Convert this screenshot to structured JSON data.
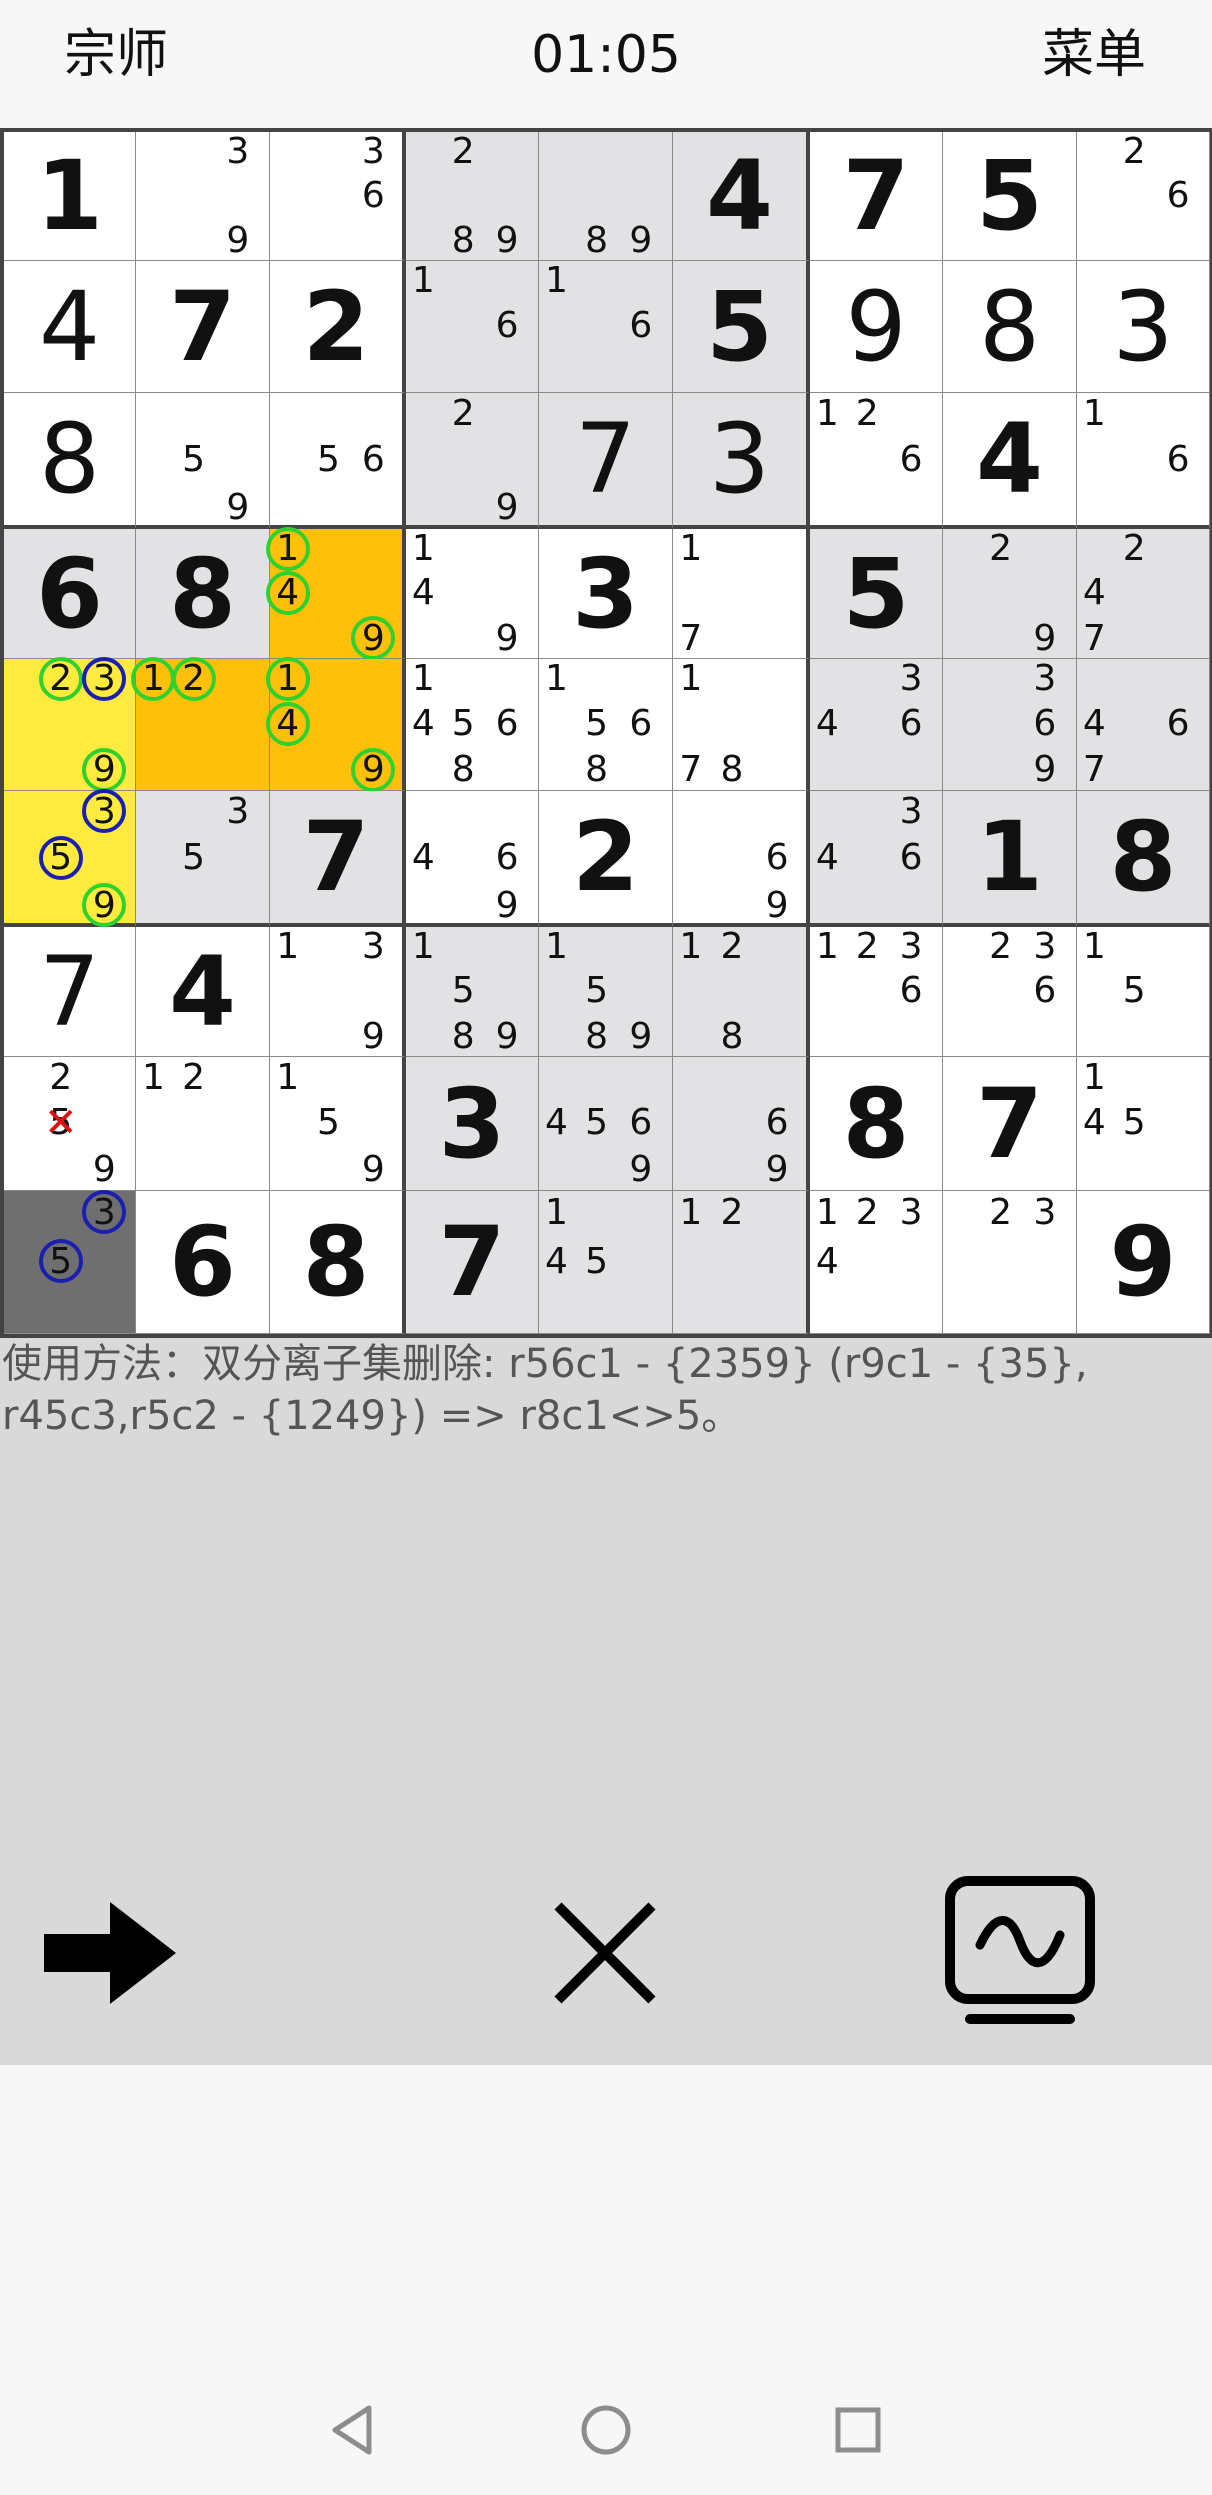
{
  "header": {
    "level": "宗师",
    "timer": "01:05",
    "menu": "菜单"
  },
  "grid": [
    [
      {
        "v": "1",
        "bg": "white"
      },
      {
        "c": [
          "3",
          "9"
        ],
        "bg": "white"
      },
      {
        "c": [
          "3",
          "6"
        ],
        "bg": "white"
      },
      {
        "c": [
          "2",
          "8",
          "9"
        ],
        "bg": "gray"
      },
      {
        "c": [
          "8",
          "9"
        ],
        "bg": "gray"
      },
      {
        "v": "4",
        "bg": "gray"
      },
      {
        "v": "7",
        "bg": "white"
      },
      {
        "v": "5",
        "bg": "white"
      },
      {
        "c": [
          "2",
          "6"
        ],
        "bg": "white"
      }
    ],
    [
      {
        "v": "4",
        "u": true,
        "bg": "white"
      },
      {
        "v": "7",
        "bg": "white"
      },
      {
        "v": "2",
        "bg": "white"
      },
      {
        "c": [
          "1",
          "6"
        ],
        "bg": "gray"
      },
      {
        "c": [
          "1",
          "6"
        ],
        "bg": "gray"
      },
      {
        "v": "5",
        "bg": "gray"
      },
      {
        "v": "9",
        "u": true,
        "bg": "white"
      },
      {
        "v": "8",
        "u": true,
        "bg": "white"
      },
      {
        "v": "3",
        "u": true,
        "bg": "white"
      }
    ],
    [
      {
        "v": "8",
        "u": true,
        "bg": "white"
      },
      {
        "c": [
          "5",
          "9"
        ],
        "bg": "white"
      },
      {
        "c": [
          "5",
          "6"
        ],
        "bg": "white"
      },
      {
        "c": [
          "2",
          "9"
        ],
        "bg": "gray"
      },
      {
        "v": "7",
        "u": true,
        "bg": "gray"
      },
      {
        "v": "3",
        "u": true,
        "bg": "gray"
      },
      {
        "c": [
          "1",
          "2",
          "6"
        ],
        "bg": "white"
      },
      {
        "v": "4",
        "bg": "white"
      },
      {
        "c": [
          "1",
          "6"
        ],
        "bg": "white"
      }
    ],
    [
      {
        "v": "6",
        "bg": "gray"
      },
      {
        "v": "8",
        "bg": "gray"
      },
      {
        "c": [
          "1",
          "4",
          "9"
        ],
        "g": [
          "1",
          "4",
          "9"
        ],
        "bg": "orange"
      },
      {
        "c": [
          "1",
          "4",
          "9"
        ],
        "bg": "white"
      },
      {
        "v": "3",
        "bg": "white"
      },
      {
        "c": [
          "1",
          "7"
        ],
        "bg": "white"
      },
      {
        "v": "5",
        "bg": "gray"
      },
      {
        "c": [
          "2",
          "9"
        ],
        "bg": "gray"
      },
      {
        "c": [
          "2",
          "4",
          "7"
        ],
        "bg": "gray"
      }
    ],
    [
      {
        "c": [
          "2",
          "3",
          "9"
        ],
        "g": [
          "2",
          "9"
        ],
        "b": [
          "3"
        ],
        "bg": "yellow"
      },
      {
        "c": [
          "1",
          "2"
        ],
        "g": [
          "1",
          "2"
        ],
        "bg": "orange"
      },
      {
        "c": [
          "1",
          "4",
          "9"
        ],
        "g": [
          "1",
          "4",
          "9"
        ],
        "bg": "orange"
      },
      {
        "c": [
          "1",
          "4",
          "5",
          "6",
          "8"
        ],
        "bg": "white"
      },
      {
        "c": [
          "1",
          "5",
          "6",
          "8"
        ],
        "bg": "white"
      },
      {
        "c": [
          "1",
          "7",
          "8"
        ],
        "bg": "white"
      },
      {
        "c": [
          "3",
          "4",
          "6"
        ],
        "bg": "gray"
      },
      {
        "c": [
          "3",
          "6",
          "9"
        ],
        "bg": "gray"
      },
      {
        "c": [
          "4",
          "6",
          "7"
        ],
        "bg": "gray"
      }
    ],
    [
      {
        "c": [
          "3",
          "5",
          "9"
        ],
        "g": [
          "9"
        ],
        "b": [
          "3",
          "5"
        ],
        "bg": "yellow"
      },
      {
        "c": [
          "3",
          "5"
        ],
        "bg": "gray"
      },
      {
        "v": "7",
        "bg": "gray"
      },
      {
        "c": [
          "4",
          "6",
          "9"
        ],
        "bg": "white"
      },
      {
        "v": "2",
        "bg": "white"
      },
      {
        "c": [
          "6",
          "9"
        ],
        "bg": "white"
      },
      {
        "c": [
          "3",
          "4",
          "6"
        ],
        "bg": "gray"
      },
      {
        "v": "1",
        "bg": "gray"
      },
      {
        "v": "8",
        "bg": "gray"
      }
    ],
    [
      {
        "v": "7",
        "u": true,
        "bg": "white"
      },
      {
        "v": "4",
        "bg": "white"
      },
      {
        "c": [
          "1",
          "3",
          "9"
        ],
        "bg": "white"
      },
      {
        "c": [
          "1",
          "5",
          "8",
          "9"
        ],
        "bg": "gray"
      },
      {
        "c": [
          "1",
          "5",
          "8",
          "9"
        ],
        "bg": "gray"
      },
      {
        "c": [
          "1",
          "2",
          "8"
        ],
        "bg": "gray"
      },
      {
        "c": [
          "1",
          "2",
          "3",
          "6"
        ],
        "bg": "white"
      },
      {
        "c": [
          "2",
          "3",
          "6"
        ],
        "bg": "white"
      },
      {
        "c": [
          "1",
          "5"
        ],
        "bg": "white"
      }
    ],
    [
      {
        "c": [
          "2",
          "5",
          "9"
        ],
        "x": [
          "5"
        ],
        "bg": "white"
      },
      {
        "c": [
          "1",
          "2"
        ],
        "bg": "white"
      },
      {
        "c": [
          "1",
          "5",
          "9"
        ],
        "bg": "white"
      },
      {
        "v": "3",
        "bg": "gray"
      },
      {
        "c": [
          "4",
          "5",
          "6",
          "9"
        ],
        "bg": "gray"
      },
      {
        "c": [
          "6",
          "9"
        ],
        "bg": "gray"
      },
      {
        "v": "8",
        "bg": "white"
      },
      {
        "v": "7",
        "bg": "white"
      },
      {
        "c": [
          "1",
          "4",
          "5"
        ],
        "bg": "white"
      }
    ],
    [
      {
        "c": [
          "3",
          "5"
        ],
        "b": [
          "3",
          "5"
        ],
        "bg": "dark"
      },
      {
        "v": "6",
        "bg": "white"
      },
      {
        "v": "8",
        "bg": "white"
      },
      {
        "v": "7",
        "bg": "gray"
      },
      {
        "c": [
          "1",
          "4",
          "5"
        ],
        "bg": "gray"
      },
      {
        "c": [
          "1",
          "2"
        ],
        "bg": "gray"
      },
      {
        "c": [
          "1",
          "2",
          "3",
          "4"
        ],
        "bg": "white"
      },
      {
        "c": [
          "2",
          "3"
        ],
        "bg": "white"
      },
      {
        "v": "9",
        "bg": "white"
      }
    ]
  ],
  "hint": {
    "text": "使用方法：双分离子集删除: r56c1 - {2359} (r9c1 - {35}, r45c3,r5c2 - {1249}) => r8c1<>5。"
  },
  "toolbar": {
    "next_icon": "arrow-right-icon",
    "close_icon": "close-icon",
    "wave_icon": "monitor-wave-icon"
  },
  "nav": {
    "back_icon": "back-triangle-icon",
    "home_icon": "home-circle-icon",
    "recent_icon": "recent-square-icon"
  },
  "colors": {
    "yellow": "#feeb3d",
    "orange": "#fec00b",
    "gray": "#e2e1e3",
    "dark": "#6f6f6f",
    "ring_green": "#2fd12f",
    "ring_blue": "#1a1fb0",
    "cross": "#e01010"
  }
}
